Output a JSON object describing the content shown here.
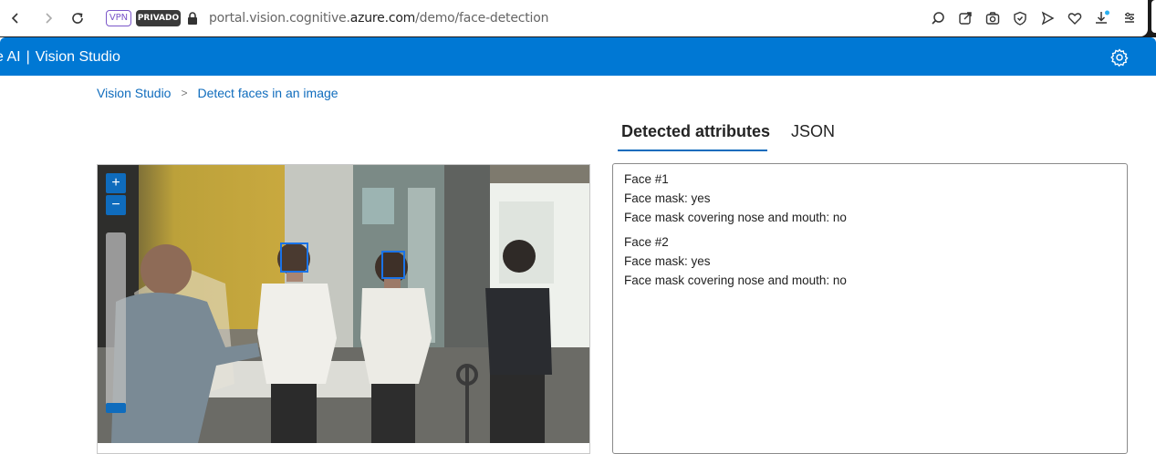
{
  "browser": {
    "vpn_label": "VPN",
    "private_label": "PRIVADO",
    "url_prefix": "portal.vision.cognitive.",
    "url_domain": "azure.com",
    "url_path": "/demo/face-detection"
  },
  "app": {
    "title_partial": "e AI",
    "separator": "|",
    "name": "Vision Studio"
  },
  "breadcrumb": {
    "items": [
      "Vision Studio",
      "Detect faces in an image"
    ],
    "separator": ">"
  },
  "tabs": [
    {
      "label": "Detected attributes",
      "active": true
    },
    {
      "label": "JSON",
      "active": false
    }
  ],
  "zoom": {
    "in_label": "+",
    "out_label": "−"
  },
  "results": {
    "faces": [
      {
        "title": "Face #1",
        "mask": "Face mask: yes",
        "cover": "Face mask covering nose and mouth: no"
      },
      {
        "title": "Face #2",
        "mask": "Face mask: yes",
        "cover": "Face mask covering nose and mouth: no"
      }
    ]
  },
  "colors": {
    "brand_blue": "#0078d4",
    "link_blue": "#0f6cbd",
    "face_box": "#1a73e8"
  },
  "icons": [
    "back-arrow-icon",
    "forward-arrow-icon",
    "reload-icon",
    "lock-icon",
    "search-icon",
    "share-icon",
    "camera-icon",
    "shield-icon",
    "send-icon",
    "heart-icon",
    "download-icon",
    "menu-icon",
    "gear-icon"
  ]
}
